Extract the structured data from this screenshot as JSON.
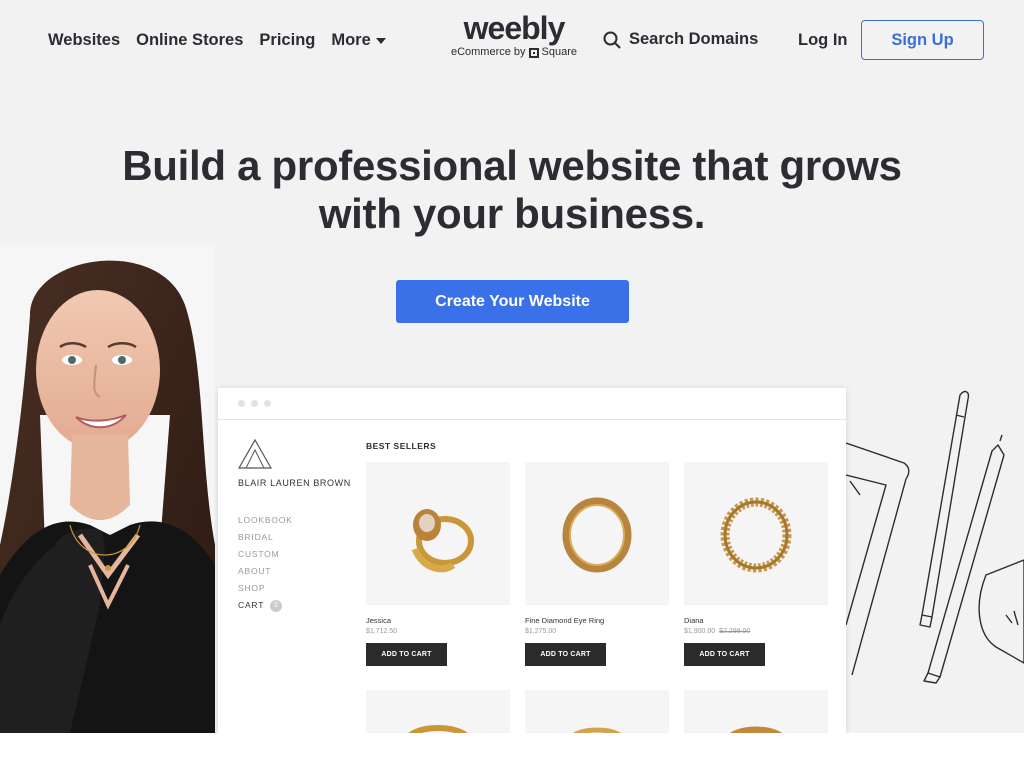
{
  "header": {
    "nav": {
      "websites": "Websites",
      "online_stores": "Online Stores",
      "pricing": "Pricing",
      "more": "More"
    },
    "logo": {
      "word": "weebly",
      "sub_prefix": "eCommerce by",
      "sub_suffix": "Square"
    },
    "search_label": "Search Domains",
    "login_label": "Log In",
    "signup_label": "Sign Up"
  },
  "hero": {
    "title_line1": "Build a professional website that grows",
    "title_line2": "with your business.",
    "cta_label": "Create Your Website"
  },
  "mockup": {
    "brand_name": "BLAIR LAUREN BROWN",
    "menu": {
      "lookbook": "LOOKBOOK",
      "bridal": "BRIDAL",
      "custom": "CUSTOM",
      "about": "ABOUT",
      "shop": "SHOP",
      "cart": "CART",
      "cart_count": "2"
    },
    "section_title": "BEST SELLERS",
    "products": [
      {
        "name": "Jessica",
        "price": "$1,712.50",
        "old_price": ""
      },
      {
        "name": "Fine Diamond Eye Ring",
        "price": "$1,275.00",
        "old_price": ""
      },
      {
        "name": "Diana",
        "price": "$1,900.00",
        "old_price": "$2,299.00"
      }
    ],
    "add_to_cart_label": "ADD TO CART"
  },
  "colors": {
    "accent": "#3a71e8",
    "text": "#2b2d33",
    "background": "#f2f2f3",
    "gold": "#c9963a"
  }
}
